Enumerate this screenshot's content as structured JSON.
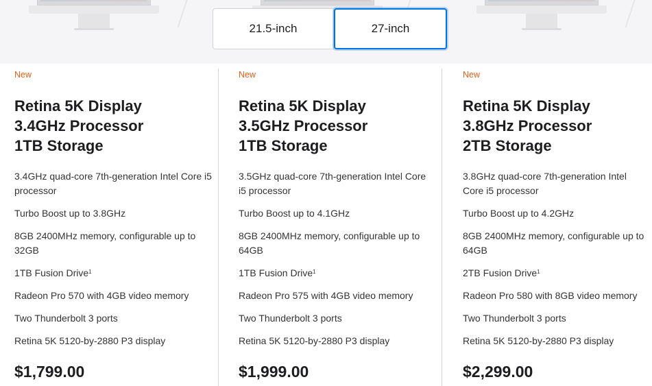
{
  "selector": {
    "options": [
      "21.5-inch",
      "27-inch"
    ],
    "selected": "27-inch"
  },
  "products": [
    {
      "badge": "New",
      "title": [
        "Retina 5K Display",
        "3.4GHz Processor",
        "1TB Storage"
      ],
      "specs": [
        "3.4GHz quad-core 7th-generation Intel Core i5 processor",
        "Turbo Boost up to 3.8GHz",
        "8GB 2400MHz memory, configurable up to 32GB",
        "1TB Fusion Drive",
        "Radeon Pro 570 with 4GB video memory",
        "Two Thunderbolt 3 ports",
        "Retina 5K 5120-by-2880 P3 display"
      ],
      "footnote_marker": "1",
      "price": "$1,799.00"
    },
    {
      "badge": "New",
      "title": [
        "Retina 5K Display",
        "3.5GHz Processor",
        "1TB Storage"
      ],
      "specs": [
        "3.5GHz quad-core 7th-generation Intel Core i5 processor",
        "Turbo Boost up to 4.1GHz",
        "8GB 2400MHz memory, configurable up to 64GB",
        "1TB Fusion Drive",
        "Radeon Pro 575 with 4GB video memory",
        "Two Thunderbolt 3 ports",
        "Retina 5K 5120-by-2880 P3 display"
      ],
      "footnote_marker": "1",
      "price": "$1,999.00"
    },
    {
      "badge": "New",
      "title": [
        "Retina 5K Display",
        "3.8GHz Processor",
        "2TB Storage"
      ],
      "specs": [
        "3.8GHz quad-core 7th-generation Intel Core i5 processor",
        "Turbo Boost up to 4.2GHz",
        "8GB 2400MHz memory, configurable up to 64GB",
        "2TB Fusion Drive",
        "Radeon Pro 580 with 8GB video memory",
        "Two Thunderbolt 3 ports",
        "Retina 5K 5120-by-2880 P3 display"
      ],
      "footnote_marker": "1",
      "price": "$2,299.00"
    }
  ],
  "colors": {
    "badge": "#e0621a",
    "accent": "#0071e3",
    "band_bg": "#f5f5f7",
    "divider": "#d2d2d7"
  }
}
